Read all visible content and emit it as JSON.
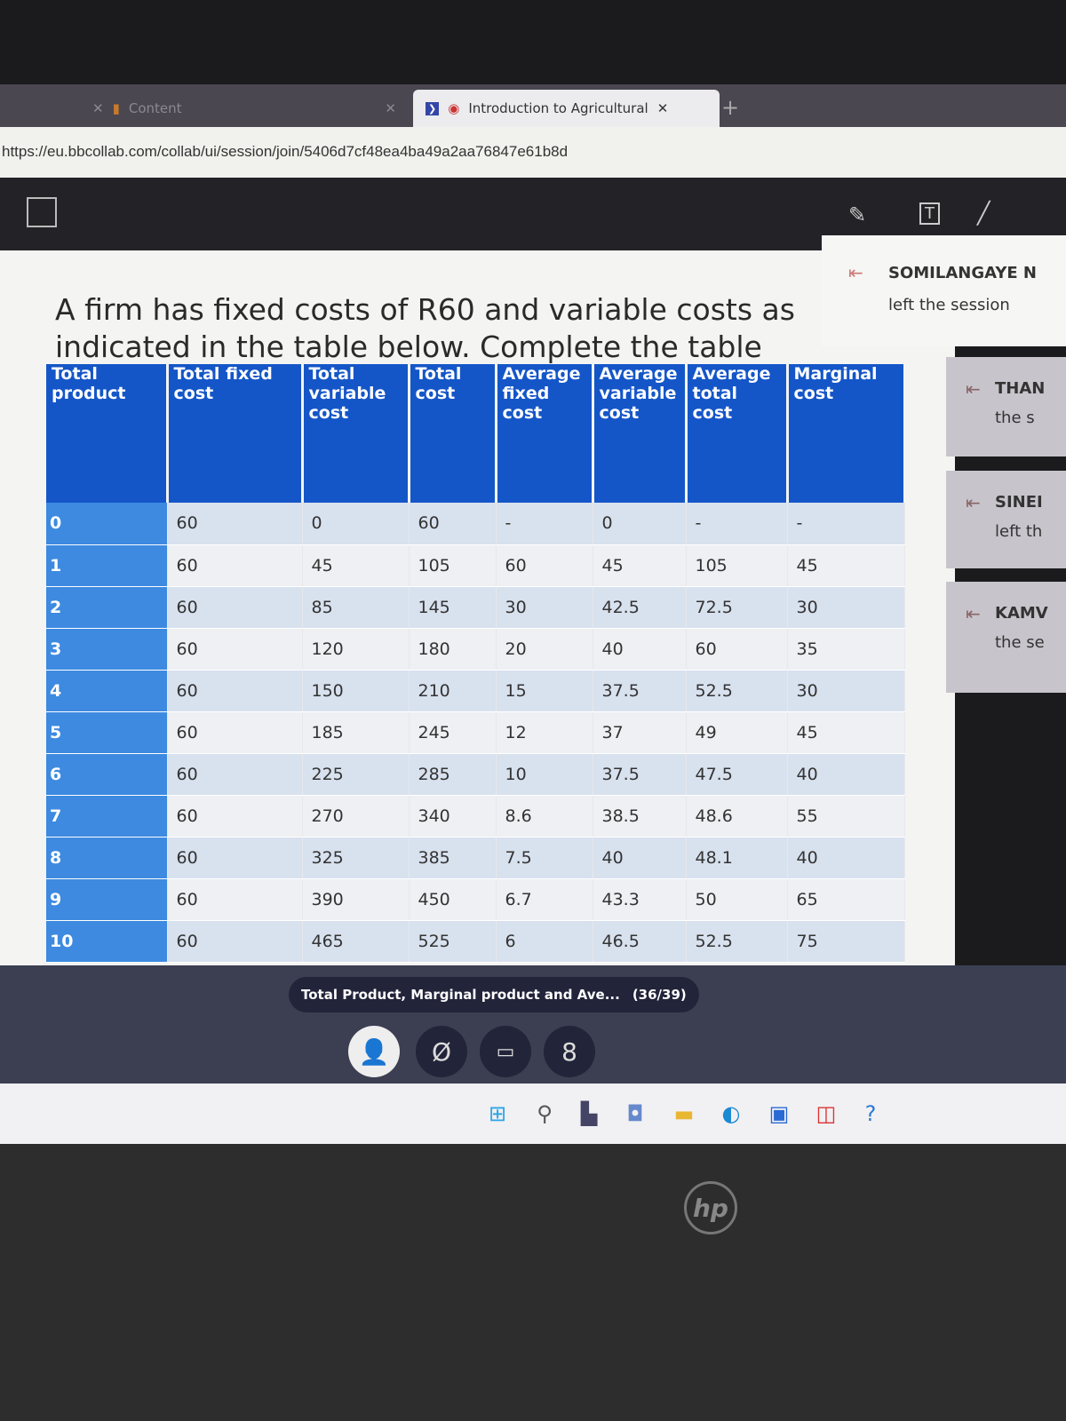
{
  "browser": {
    "tabs": [
      {
        "label": "Content"
      },
      {
        "label": "Introduction to Agricultural"
      }
    ],
    "url": "https://eu.bbcollab.com/collab/ui/session/join/5406d7cf48ea4ba49a2aa76847e61b8d"
  },
  "slide": {
    "question": "A firm has fixed costs of R60 and variable costs as indicated in the table below. Complete the table",
    "headers": [
      "Total product",
      "Total fixed cost",
      "Total variable cost",
      "Total cost",
      "Average fixed cost",
      "Average variable cost",
      "Average total cost",
      "Marginal cost"
    ],
    "rows": [
      [
        "0",
        "60",
        "0",
        "60",
        "-",
        "0",
        "-",
        "-"
      ],
      [
        "1",
        "60",
        "45",
        "105",
        "60",
        "45",
        "105",
        "45"
      ],
      [
        "2",
        "60",
        "85",
        "145",
        "30",
        "42.5",
        "72.5",
        "30"
      ],
      [
        "3",
        "60",
        "120",
        "180",
        "20",
        "40",
        "60",
        "35"
      ],
      [
        "4",
        "60",
        "150",
        "210",
        "15",
        "37.5",
        "52.5",
        "30"
      ],
      [
        "5",
        "60",
        "185",
        "245",
        "12",
        "37",
        "49",
        "45"
      ],
      [
        "6",
        "60",
        "225",
        "285",
        "10",
        "37.5",
        "47.5",
        "40"
      ],
      [
        "7",
        "60",
        "270",
        "340",
        "8.6",
        "38.5",
        "48.6",
        "55"
      ],
      [
        "8",
        "60",
        "325",
        "385",
        "7.5",
        "40",
        "48.1",
        "40"
      ],
      [
        "9",
        "60",
        "390",
        "450",
        "6.7",
        "43.3",
        "50",
        "65"
      ],
      [
        "10",
        "60",
        "465",
        "525",
        "6",
        "46.5",
        "52.5",
        "75"
      ]
    ]
  },
  "notifications": [
    {
      "name": "SOMILANGAYE N",
      "text": "left the session"
    },
    {
      "name": "THAN",
      "text": "the s"
    },
    {
      "name": "SINEI",
      "text": "left th"
    },
    {
      "name": "KAMV",
      "text": "the se"
    }
  ],
  "session": {
    "slide_title": "Total Product, Marginal product and Ave...",
    "slide_count": "(36/39)"
  },
  "colors": {
    "header_blue": "#1456c8",
    "product_blue": "#3d8ae0"
  }
}
